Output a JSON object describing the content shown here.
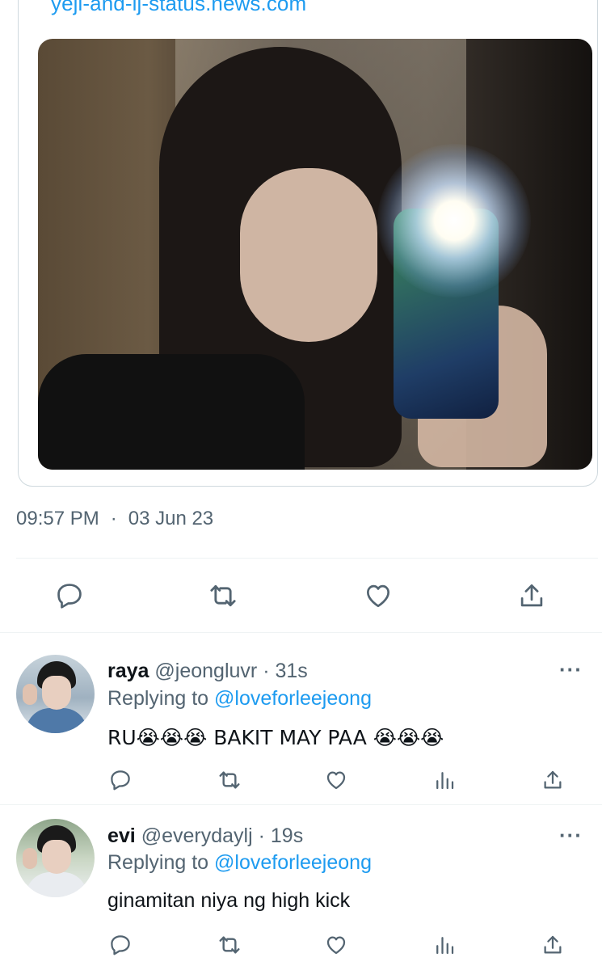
{
  "card": {
    "domain": "yeji-and-lj-status.news.com"
  },
  "tweet": {
    "time": "09:57 PM",
    "separator": "·",
    "date": "03 Jun 23"
  },
  "actions": {
    "icons": [
      "reply-icon",
      "retweet-icon",
      "like-icon",
      "share-icon"
    ]
  },
  "replies": [
    {
      "name": "raya",
      "handle": "@jeongluvr",
      "dot": "·",
      "age": "31s",
      "replying_prefix": "Replying to",
      "replying_to": "@loveforleejeong",
      "text": "RU😭😭😭 BAKIT MAY PAA 😭😭😭",
      "more": "···"
    },
    {
      "name": "evi",
      "handle": "@everydaylj",
      "dot": "·",
      "age": "19s",
      "replying_prefix": "Replying to",
      "replying_to": "@loveforleejeong",
      "text": "ginamitan niya ng high kick",
      "more": "···"
    }
  ],
  "colors": {
    "accent": "#1d9bf0",
    "secondary_text": "#536471",
    "primary_text": "#0f1419",
    "divider": "#eff3f4"
  }
}
